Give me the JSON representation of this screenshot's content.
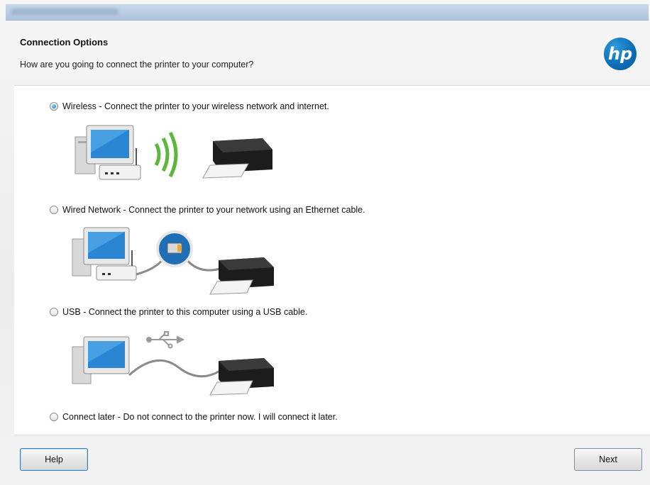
{
  "window": {
    "title": "HP Officejet Pro 8600 series Printer"
  },
  "header": {
    "title": "Connection Options",
    "subtitle": "How are you going to connect the printer to your computer?",
    "logo_text": "hp",
    "logo_color": "#0b6bb6"
  },
  "options": [
    {
      "label": "Wireless - Connect the printer to your wireless network and internet.",
      "selected": true,
      "icon": "wireless-illustration"
    },
    {
      "label": "Wired Network - Connect the printer to your network using an Ethernet cable.",
      "selected": false,
      "icon": "ethernet-illustration"
    },
    {
      "label": "USB - Connect the printer to this computer using a USB cable.",
      "selected": false,
      "icon": "usb-illustration"
    },
    {
      "label": "Connect later - Do not connect to the printer now. I will connect it later.",
      "selected": false,
      "icon": null
    }
  ],
  "footer": {
    "help_label": "Help",
    "next_label": "Next"
  },
  "colors": {
    "accent": "#3c7fb1",
    "wifi_green": "#5cb83c"
  }
}
